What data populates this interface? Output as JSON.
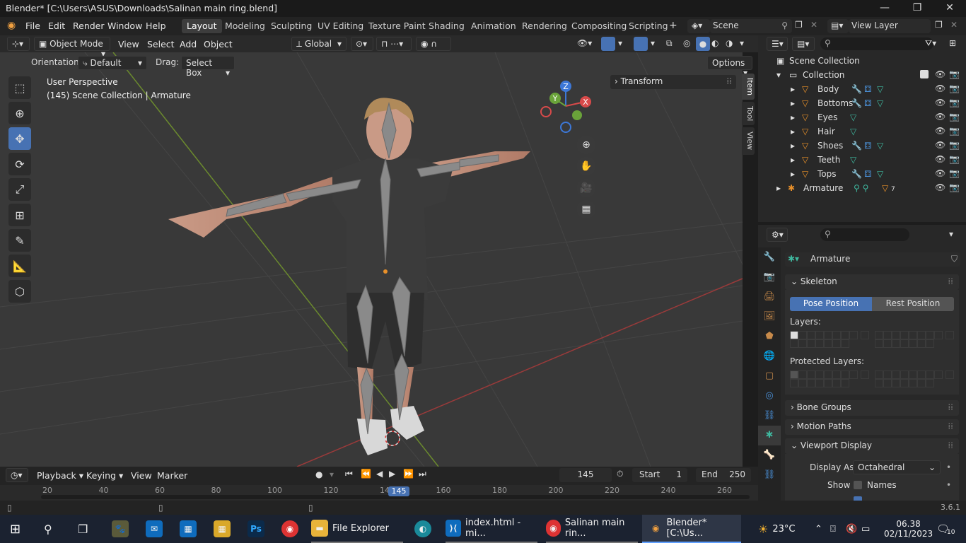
{
  "window": {
    "title": "Blender* [C:\\Users\\ASUS\\Downloads\\Salinan main ring.blend]"
  },
  "menu": {
    "items": [
      "File",
      "Edit",
      "Render",
      "Window",
      "Help"
    ]
  },
  "workspaces": [
    "Layout",
    "Modeling",
    "Sculpting",
    "UV Editing",
    "Texture Paint",
    "Shading",
    "Animation",
    "Rendering",
    "Compositing",
    "Scripting"
  ],
  "active_workspace": "Layout",
  "scene": {
    "name": "Scene",
    "view_layer": "View Layer"
  },
  "header": {
    "mode": "Object Mode",
    "menus": [
      "View",
      "Select",
      "Add",
      "Object"
    ],
    "orientation": "Global"
  },
  "tool_settings": {
    "orientation_label": "Orientation:",
    "orientation_value": "Default",
    "drag_label": "Drag:",
    "drag_value": "Select Box",
    "options": "Options"
  },
  "viewport": {
    "perspective": "User Perspective",
    "info": "(145) Scene Collection | Armature",
    "transform_panel": "Transform",
    "tabs": [
      "Item",
      "Tool",
      "View"
    ],
    "gizmo": {
      "z": "Z",
      "y": "Y",
      "x": "X"
    }
  },
  "outliner": {
    "root": "Scene Collection",
    "collection": "Collection",
    "items": [
      {
        "name": "Body",
        "count": ""
      },
      {
        "name": "Bottoms",
        "count": ""
      },
      {
        "name": "Eyes",
        "count": ""
      },
      {
        "name": "Hair",
        "count": ""
      },
      {
        "name": "Shoes",
        "count": ""
      },
      {
        "name": "Teeth",
        "count": ""
      },
      {
        "name": "Tops",
        "count": ""
      }
    ],
    "armature": {
      "name": "Armature",
      "count": "7"
    }
  },
  "properties": {
    "object_name": "Armature",
    "skeleton": "Skeleton",
    "pose_position": "Pose Position",
    "rest_position": "Rest Position",
    "layers": "Layers:",
    "protected_layers": "Protected Layers:",
    "bone_groups": "Bone Groups",
    "motion_paths": "Motion Paths",
    "viewport_display": "Viewport Display",
    "display_as_label": "Display As",
    "display_as_value": "Octahedral",
    "show_label": "Show",
    "names_label": "Names"
  },
  "timeline": {
    "menus": [
      "Playback",
      "Keying",
      "View",
      "Marker"
    ],
    "current_frame": "145",
    "start_label": "Start",
    "start": "1",
    "end_label": "End",
    "end": "250",
    "ticks": [
      "20",
      "40",
      "60",
      "80",
      "100",
      "120",
      "140",
      "160",
      "180",
      "200",
      "220",
      "240",
      "260"
    ],
    "playhead": "145"
  },
  "status": {
    "version": "3.6.1"
  },
  "taskbar": {
    "apps": [
      {
        "label": "File Explorer"
      },
      {
        "label": "index.html - mi..."
      },
      {
        "label": "Salinan main rin..."
      },
      {
        "label": "Blender* [C:\\Us..."
      }
    ],
    "weather": "23°C",
    "time": "06.38",
    "date": "02/11/2023",
    "notifications": "10"
  }
}
